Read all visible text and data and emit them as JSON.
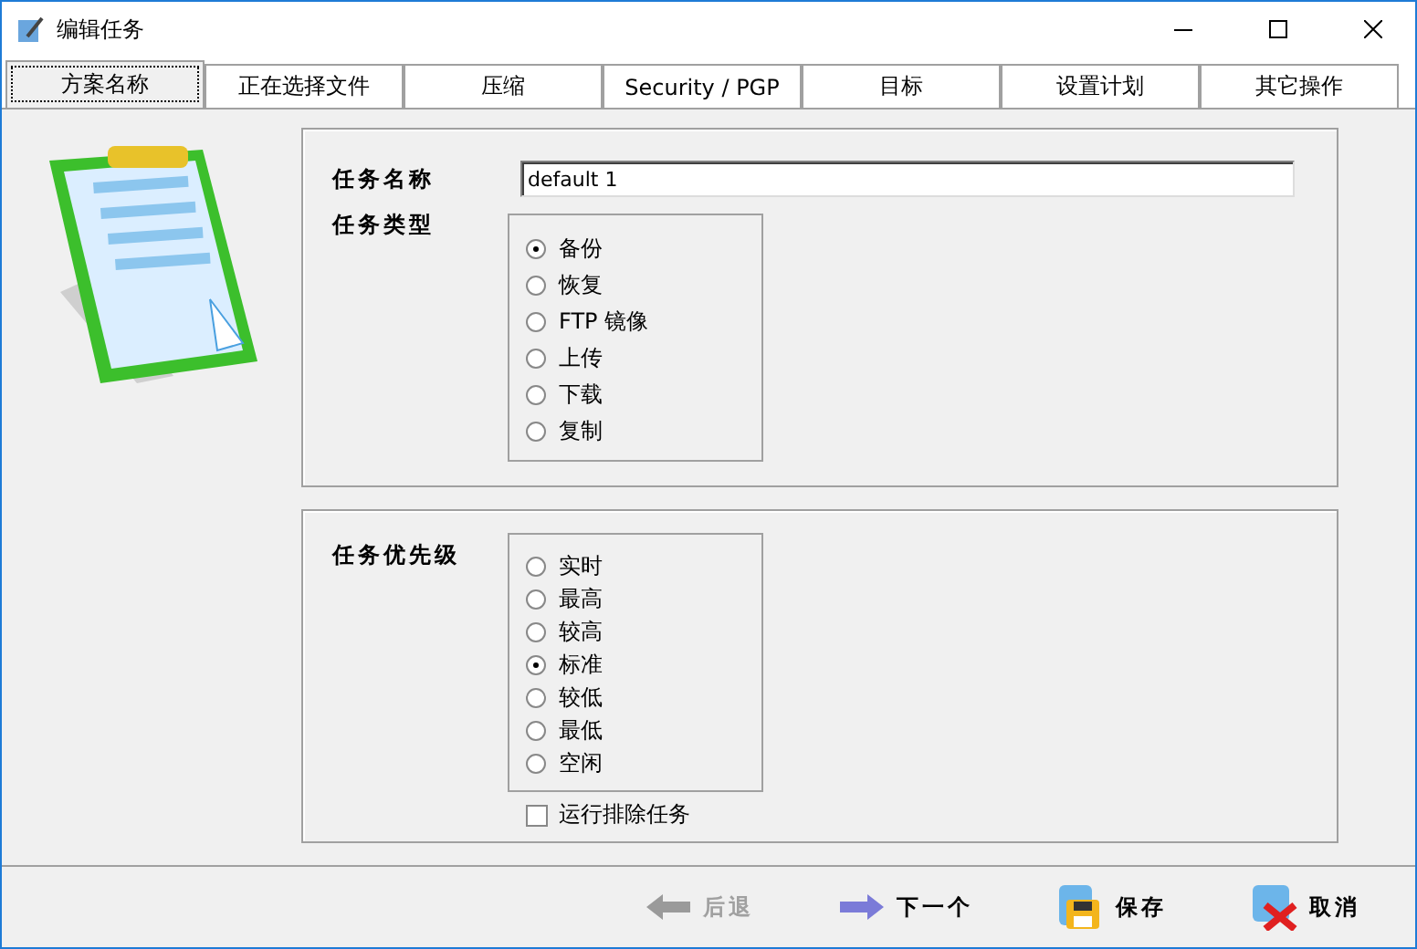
{
  "window": {
    "title": "编辑任务"
  },
  "tabs": [
    {
      "label": "方案名称",
      "selected": true
    },
    {
      "label": "正在选择文件",
      "selected": false
    },
    {
      "label": "压缩",
      "selected": false
    },
    {
      "label": "Security / PGP",
      "selected": false
    },
    {
      "label": "目标",
      "selected": false
    },
    {
      "label": "设置计划",
      "selected": false
    },
    {
      "label": "其它操作",
      "selected": false
    }
  ],
  "task_name": {
    "label": "任务名称",
    "value": "default 1"
  },
  "task_type": {
    "label": "任务类型",
    "options": [
      {
        "label": "备份",
        "selected": true
      },
      {
        "label": "恢复",
        "selected": false
      },
      {
        "label": "FTP 镜像",
        "selected": false
      },
      {
        "label": "上传",
        "selected": false
      },
      {
        "label": "下载",
        "selected": false
      },
      {
        "label": "复制",
        "selected": false
      }
    ]
  },
  "priority": {
    "label": "任务优先级",
    "options": [
      {
        "label": "实时",
        "selected": false
      },
      {
        "label": "最高",
        "selected": false
      },
      {
        "label": "较高",
        "selected": false
      },
      {
        "label": "标准",
        "selected": true
      },
      {
        "label": "较低",
        "selected": false
      },
      {
        "label": "最低",
        "selected": false
      },
      {
        "label": "空闲",
        "selected": false
      }
    ]
  },
  "run_excluded": {
    "label": "运行排除任务",
    "checked": false
  },
  "buttons": [
    {
      "kind": "back",
      "label": "后退",
      "disabled": true
    },
    {
      "kind": "next",
      "label": "下一个",
      "disabled": false
    },
    {
      "kind": "save",
      "label": "保存",
      "disabled": false
    },
    {
      "kind": "cancel",
      "label": "取消",
      "disabled": false
    }
  ]
}
